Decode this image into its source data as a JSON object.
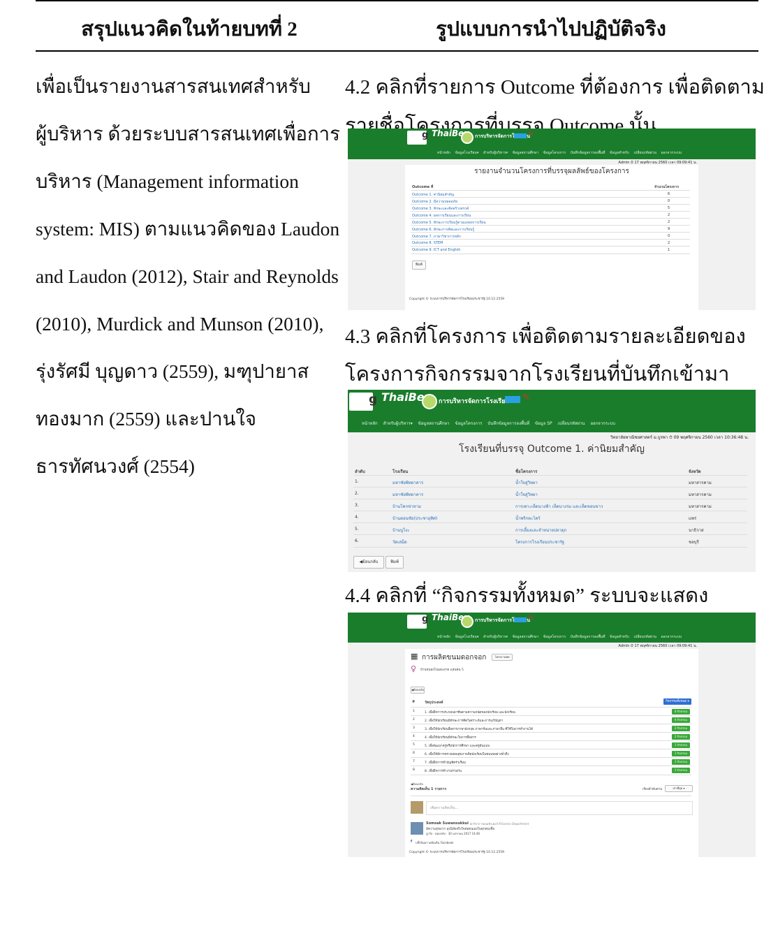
{
  "table": {
    "header_left": "สรุปแนวคิดในท้ายบทที่ 2",
    "header_right": "รูปแบบการนำไปปฏิบัติจริง"
  },
  "left_lines": [
    "เพื่อเป็นรายงานสารสนเทศสำหรับ",
    "ผู้บริหาร ด้วยระบบสารสนเทศเพื่อการ",
    "บริหาร (Management information",
    "system: MIS) ตามแนวคิดของ Laudon",
    "and Laudon (2012), Stair and Reynolds",
    "(2010), Murdick and Munson (2010),",
    "รุ่งรัศมี บุญดาว (2559), มฑุปายาส",
    "ทองมาก (2559) และปานใจ",
    "ธารทัศนวงศ์ (2554)"
  ],
  "steps": {
    "s42_l1": "4.2  คลิกที่รายการ Outcome ที่ต้องการ เพื่อติดตาม",
    "s42_l2": "รายชื่อโครงการที่บรรจุ Outcome นั้น",
    "s43_l1": "4.3  คลิกที่โครงการ เพื่อติดตามรายละเอียดของ",
    "s43_l2": "โครงการกิจกรรมจากโรงเรียนที่บันทึกเข้ามา",
    "s44_l1": "4.4  คลิกที่ “กิจกรรมทั้งหมด” ระบบจะแสดง"
  },
  "app": {
    "brand": "ThaiBev",
    "system_title": "การบริหารจัดการโรงเรียน",
    "nav": [
      "หน้าหลัก",
      "ข้อมูลโรงเรียน▾",
      "สำหรับผู้บริหาร▾",
      "ข้อมูลสถานศึกษา",
      "ข้อมูลโครงการ",
      "บันทึกข้อมูลการลงพื้นที่",
      "ข้อมูลสำหรับ",
      "เปลี่ยนรหัสผ่าน",
      "ออกจากระบบ"
    ],
    "nav2": [
      "หน้าหลัก",
      "สำหรับผู้บริหาร▾",
      "ข้อมูลสถานศึกษา",
      "ข้อมูลโครงการ",
      "บันทึกข้อมูลการลงพื้นที่",
      "ข้อมูล SP",
      "เปลี่ยนรหัสผ่าน",
      "ออกจากระบบ"
    ],
    "copyright": "Copyright © ระบบการบริหารจัดการโรงเรียนประชารัฐ 10.12.2559"
  },
  "shot1": {
    "user_line": "Admin ⏱ 17 พฤศจิกายน 2560 เวลา 09:09:41 น.",
    "page_title": "รายงานจำนวนโครงการที่บรรจุผลลัพธ์ของโครงการ",
    "col_outcome": "Outcome ที่",
    "col_count": "จำนวนโครงการ",
    "rows": [
      {
        "name": "Outcome 1. ค่านิยมสำคัญ",
        "count": "6"
      },
      {
        "name": "Outcome 2. มีความปลอดภัย",
        "count": "0"
      },
      {
        "name": "Outcome 3. ทักษะและคิดสร้างสรรค์",
        "count": "5"
      },
      {
        "name": "Outcome 4. ผลการเรียนและการเรียน",
        "count": "2"
      },
      {
        "name": "Outcome 5. ทักษะการเรียนรู้ตามแหล่งการเรียน",
        "count": "2"
      },
      {
        "name": "Outcome 6. ทักษะการคิดและการเรียนรู้",
        "count": "9"
      },
      {
        "name": "Outcome 7. ภาษาวิชาการหลัก",
        "count": "0"
      },
      {
        "name": "Outcome 8. STEM",
        "count": "2"
      },
      {
        "name": "Outcome 9. ICT and English",
        "count": "1"
      }
    ],
    "print_button": "พิมพ์"
  },
  "shot2": {
    "user_line": "วิทยาลัยพาณิชยศาสตร์ ม.บูรพา ⏱ 09 พฤศจิกายน 2560 เวลา 10:36:48 น.",
    "page_title": "โรงเรียนที่บรรจุ Outcome 1. ค่านิยมสำคัญ",
    "cols": [
      "ลำดับ",
      "โรงเรียน",
      "ชื่อโครงการ",
      "จังหวัด"
    ],
    "rows": [
      {
        "no": "1.",
        "school": "มหาชัยพิทยาคาร",
        "project": "น้ำใจสู่วิทยา",
        "province": "มหาสารคาม"
      },
      {
        "no": "2.",
        "school": "มหาชัยพิทยาคาร",
        "project": "น้ำใจสู่วิทยา",
        "province": "มหาสารคาม"
      },
      {
        "no": "3.",
        "school": "บ้านโคกข่าหาม",
        "project": "การเพาะเห็ดนางฟ้า เห็ดนางรม และเห็ดขอนขาว",
        "province": "มหาสารคาม"
      },
      {
        "no": "4.",
        "school": "บ้านดอนชัย(ประชาอุทิศ)",
        "project": "น้ำพริกตะไคร้",
        "province": "แพร่"
      },
      {
        "no": "5.",
        "school": "บ้านบูโงะ",
        "project": "การเลี้ยงและจำหน่ายปลาดุก",
        "province": "นาธิวาส"
      },
      {
        "no": "6.",
        "school": "วัดเสม็ด",
        "project": "โครงการโรงเรียนประชารัฐ",
        "province": "ชลบุรี"
      }
    ],
    "back_button": "◀ย้อนกลับ",
    "print_button": "พิมพ์"
  },
  "shot3": {
    "user_line": "Admin ⏱ 17 พฤศจิกายน 2560 เวลา 09:09:41 น.",
    "project_title": "การผลิตขนมดอกจอก",
    "project_tag": "โครงงานพด",
    "school_link": "บ้านหนองโนนสะอาด แสนคน 5",
    "back_small": "◀ย้อนกลับ",
    "col_no": "#",
    "col_goal": "วัตถุประสงค์",
    "col_action": "กิจกรรมทั้งหมด ▾",
    "rows": [
      {
        "no": "1",
        "text": "1. เพื่อฝึกการประกอบอาชีพตามความถนัดของนักเรียน และนักเรียน",
        "badge": "4 กิจกรรม"
      },
      {
        "no": "2",
        "text": "2. เพื่อให้นักเรียนมีทักษะการคิดวิเคราะห์และการแก้ปัญหา",
        "badge": "4 กิจกรรม"
      },
      {
        "no": "3",
        "text": "3. เพื่อให้นักเรียนสื่อสารภาษาอังกฤษ ภาษาจีนและภาษาอื่น ที่ใช้ในการทำงานได้",
        "badge": "2 กิจกรรม"
      },
      {
        "no": "4",
        "text": "4. เพื่อให้นักเรียนมีทักษะในการสื่อสาร",
        "badge": "2 กิจกรรม"
      },
      {
        "no": "5",
        "text": "5. เพื่อพัฒนาครูหรือนักการศึกษา และครูต้นแบบ",
        "badge": "1 กิจกรรม"
      },
      {
        "no": "6",
        "text": "6. เพื่อให้มีการตรวจสอบสุขภาพจิตนักเรียนในชนบทอย่างทั่วถึง",
        "badge": "1 กิจกรรม"
      },
      {
        "no": "7",
        "text": "7. เพื่อฝึกการทำบัญชีครัวเรือน",
        "badge": "1 กิจกรรม"
      },
      {
        "no": "8",
        "text": "8. เพื่อฝึกการทำงานร่วมกัน",
        "badge": "1 กิจกรรม"
      }
    ],
    "back_small2": "◀ย้อนกลับ",
    "comments_count": "ความคิดเห็น 1 รายการ",
    "sort_label": "เรียงลำดับตาม",
    "sort_value": "เก่าที่สุด ▾",
    "comment_placeholder": "เพิ่มความคิดเห็น...",
    "commenter_name": "Somsak Suwansukkul",
    "commenter_role": "· นักวิชาการคอมพิวเตอร์ ที่ Excess Department",
    "comment_text": "มีความสุขมาก อุปนิสัยจริงใจต่อตนเองในทุกคนเชื่อ",
    "comment_meta": "ถูกใจ · ตอบกลับ · 30 มกราคม 2017 14:46",
    "fb_plugin": "ปลั๊กอินความคิดเห็น Facebook"
  }
}
